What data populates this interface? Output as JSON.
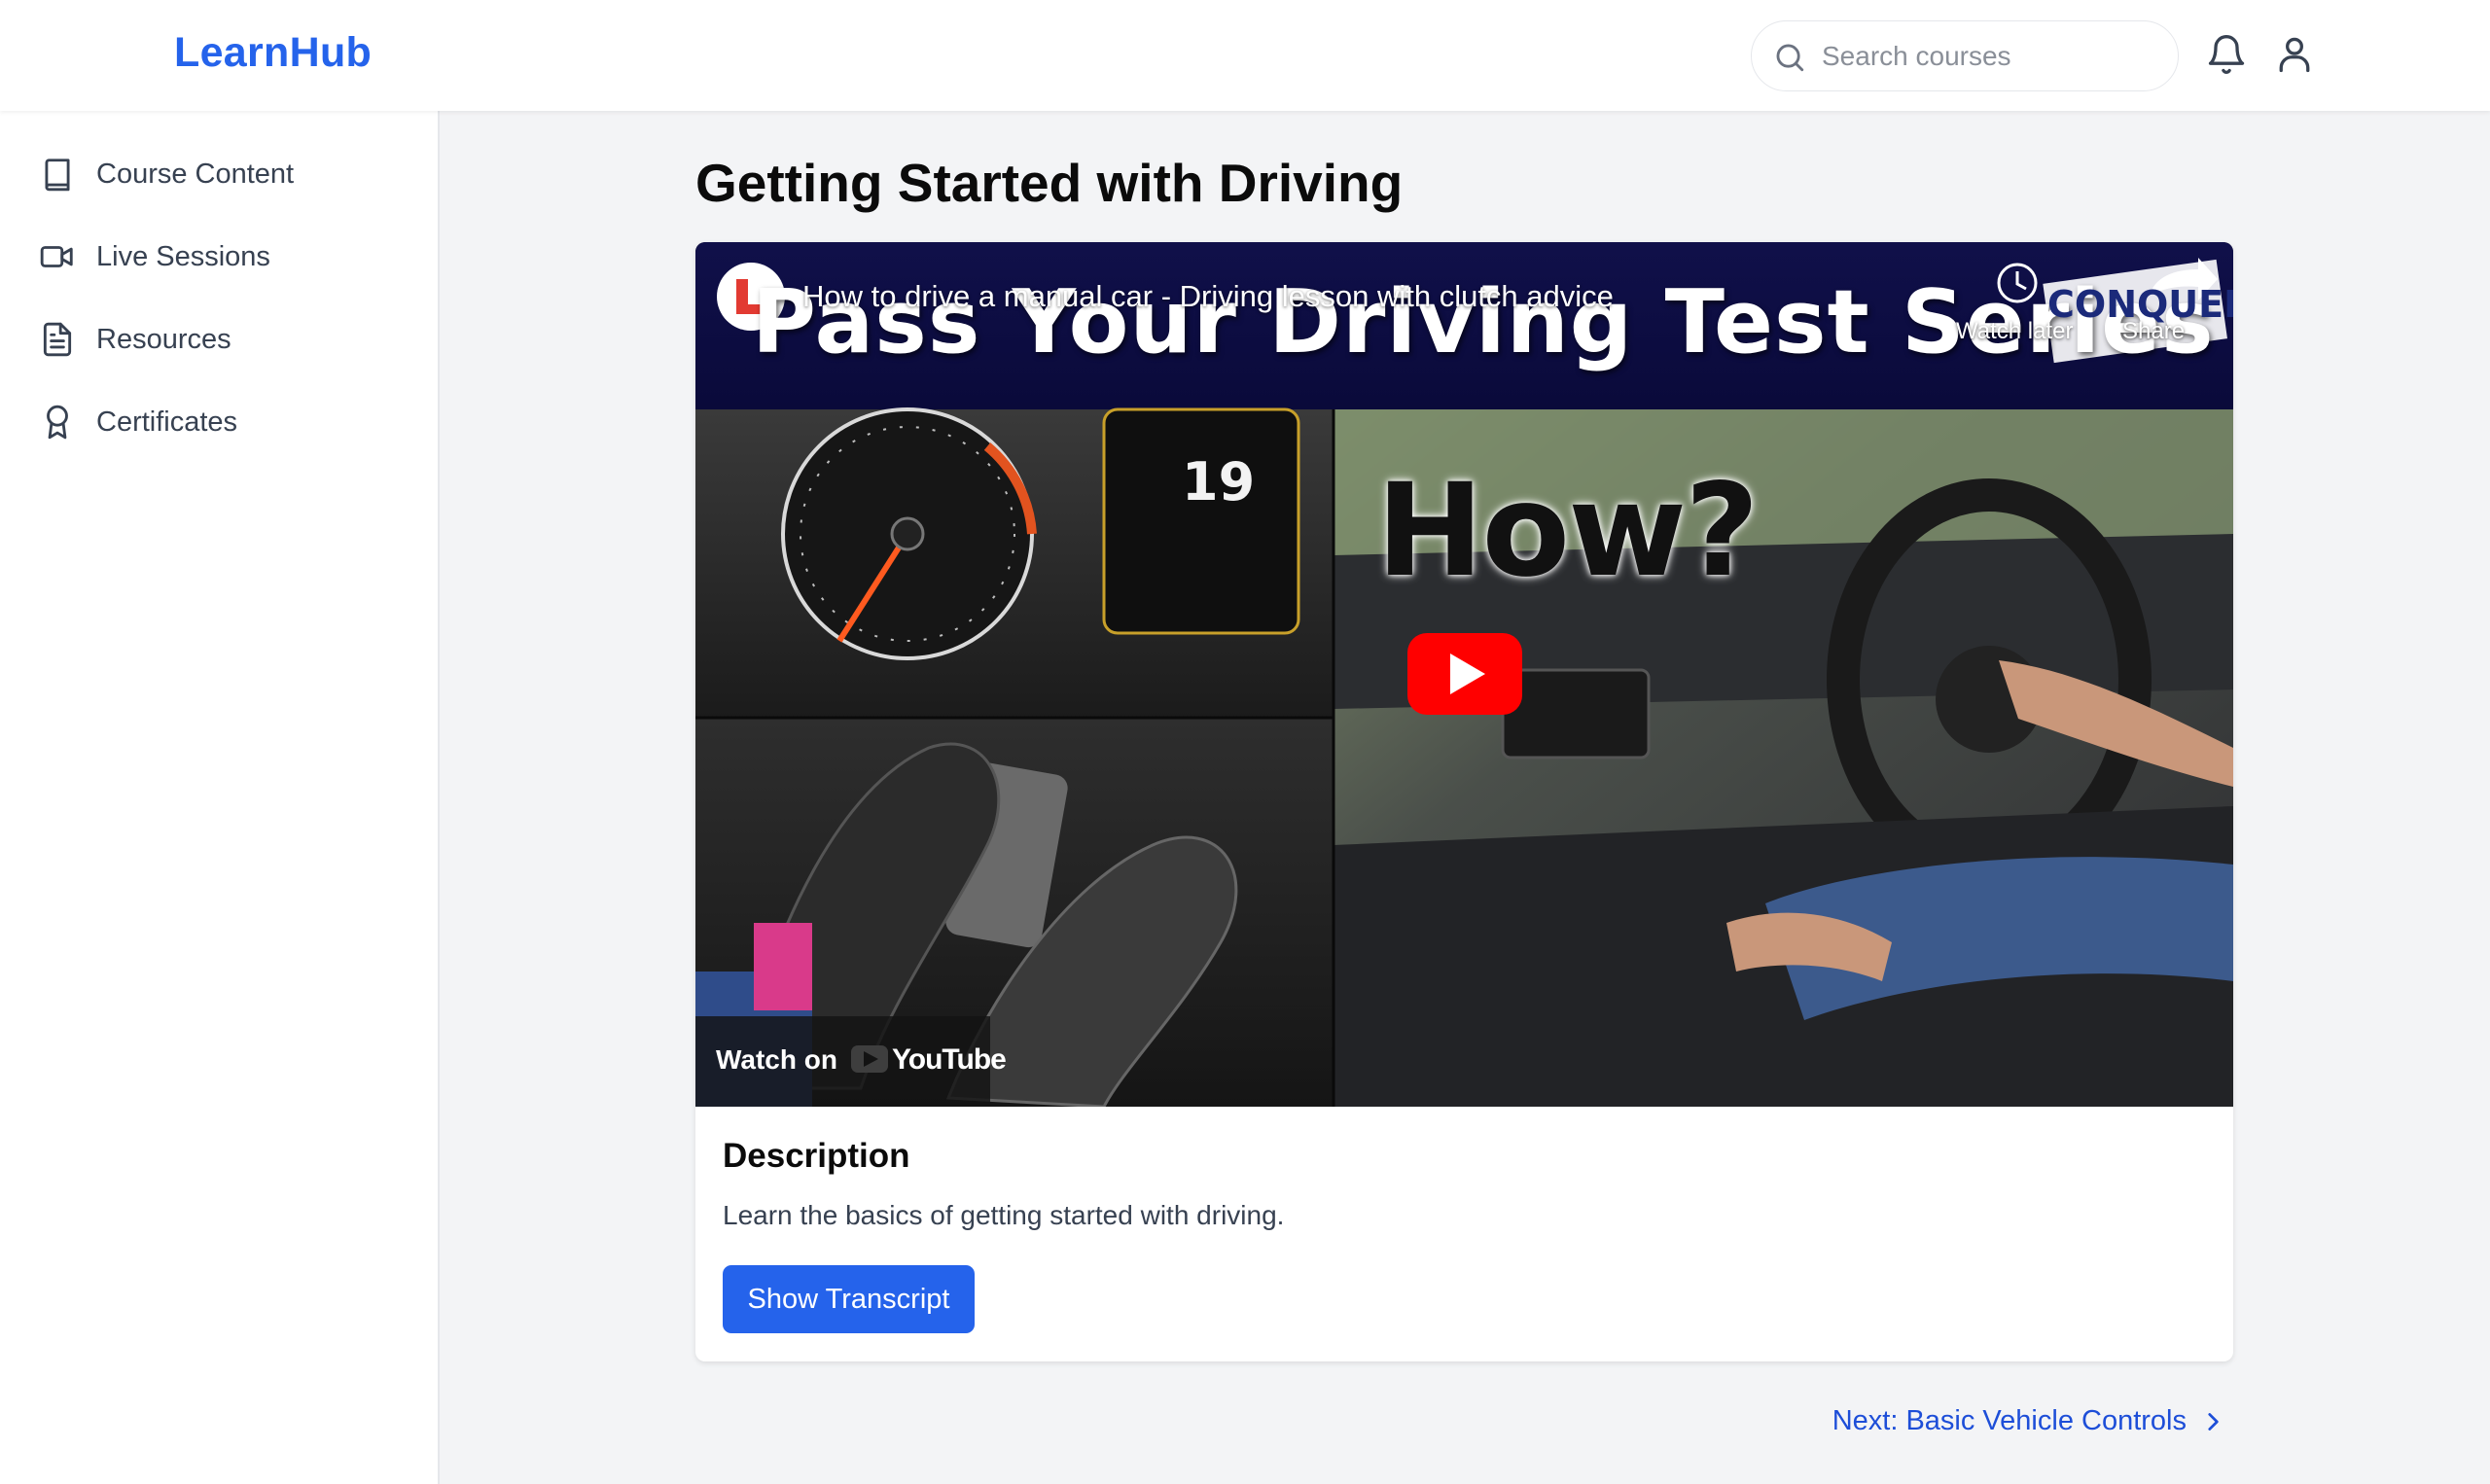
{
  "header": {
    "logo": "LearnHub",
    "search_placeholder": "Search courses",
    "search_value": ""
  },
  "sidebar": {
    "items": [
      {
        "label": "Course Content",
        "icon": "book-icon"
      },
      {
        "label": "Live Sessions",
        "icon": "video-camera-icon"
      },
      {
        "label": "Resources",
        "icon": "document-icon"
      },
      {
        "label": "Certificates",
        "icon": "award-icon"
      }
    ]
  },
  "main": {
    "page_title": "Getting Started with Driving",
    "video": {
      "title": "How to drive a manual car - Driving lesson with clutch advice",
      "watch_later": "Watch later",
      "share": "Share",
      "watch_on": "Watch on",
      "youtube": "YouTube",
      "thumbnail_banner": "Pass Your Driving Test Series",
      "thumbnail_question": "How?",
      "thumbnail_speed": "19",
      "thumbnail_brand": "CONQUER"
    },
    "description_heading": "Description",
    "description_text": "Learn the basics of getting started with driving.",
    "transcript_button": "Show Transcript",
    "next_link": "Next: Basic Vehicle Controls"
  },
  "colors": {
    "brand": "#2563eb",
    "link": "#1d4ed8",
    "page_bg": "#f3f4f6",
    "youtube_red": "#ff0000"
  }
}
